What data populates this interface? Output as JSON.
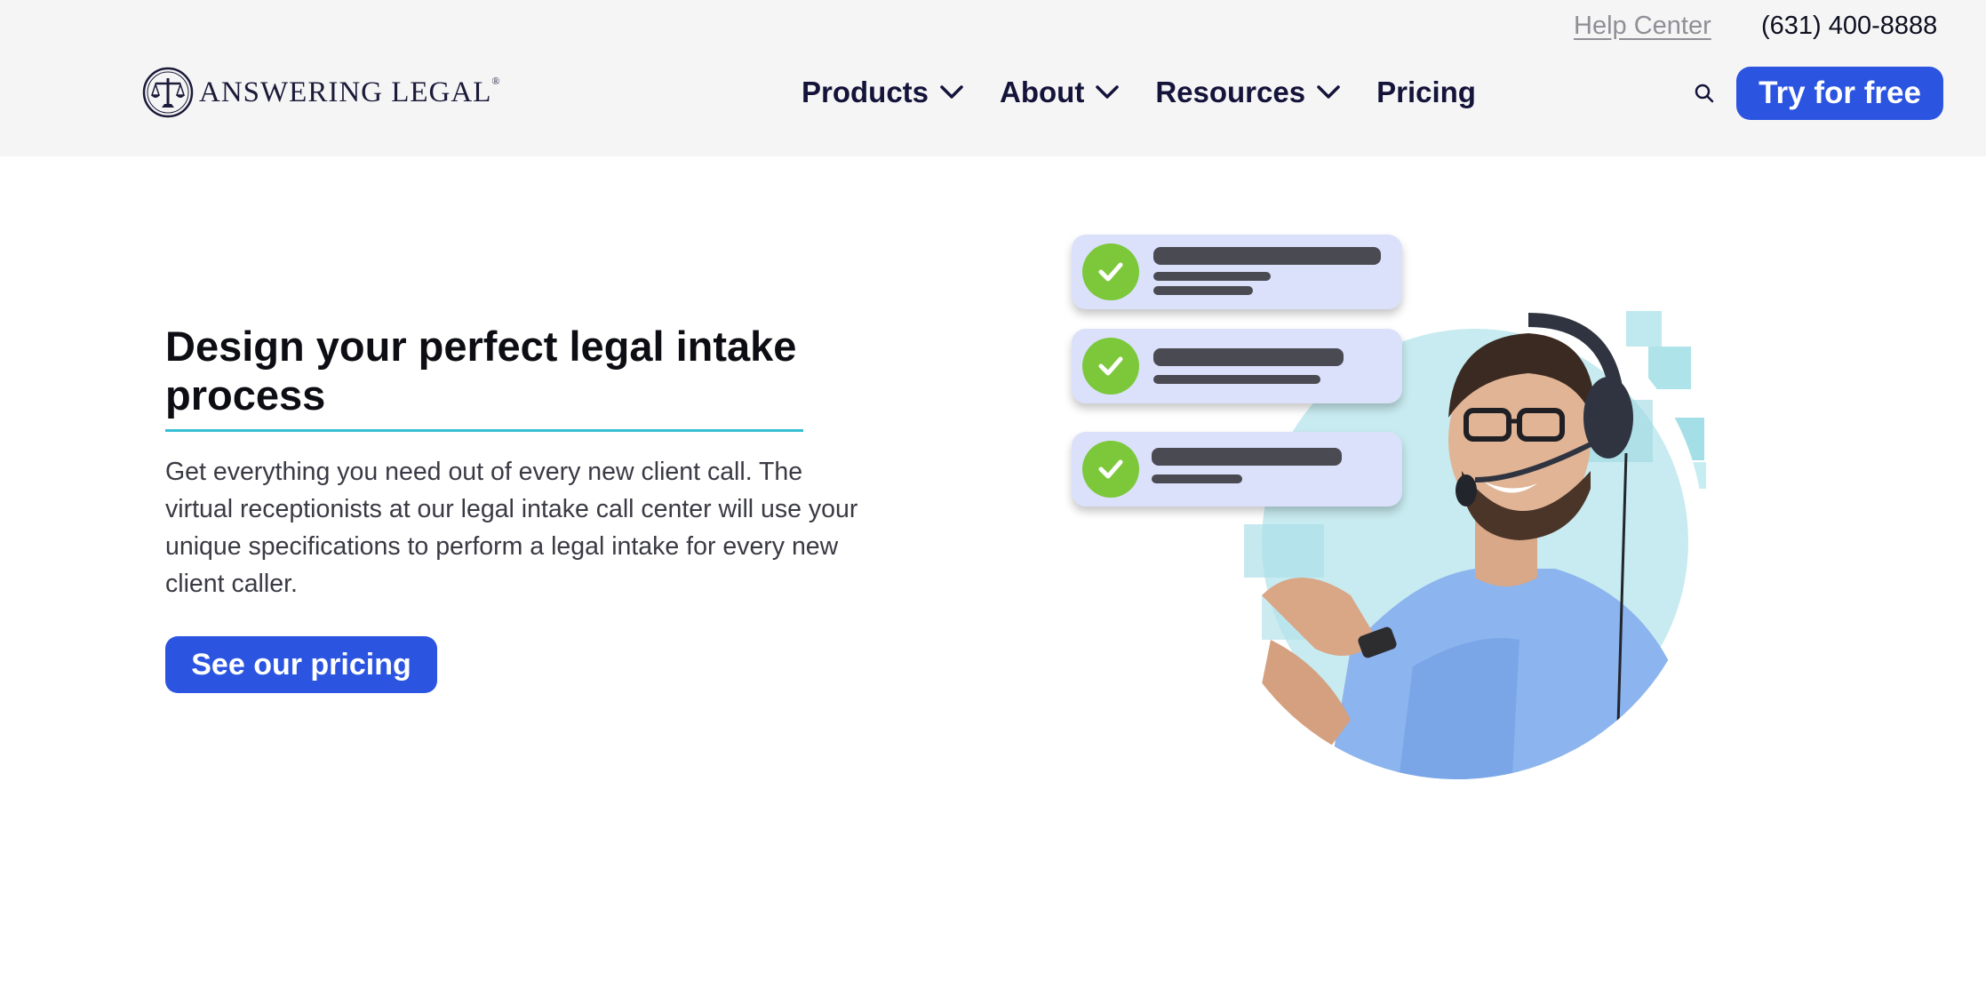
{
  "header": {
    "help_center": "Help Center",
    "phone": "(631) 400-8888",
    "logo_text": "ANSWERING LEGAL",
    "logo_reg": "®",
    "nav": [
      {
        "label": "Products"
      },
      {
        "label": "About"
      },
      {
        "label": "Resources"
      },
      {
        "label": "Pricing"
      }
    ],
    "cta_label": "Try for free",
    "search_icon": "search-icon"
  },
  "hero": {
    "title": "Design your perfect legal intake process",
    "body": "Get everything you need out of every new client call. The virtual receptionists at our legal intake call center will use your unique specifications to perform a legal intake for every new client caller.",
    "cta_label": "See our pricing"
  },
  "colors": {
    "accent_blue": "#2b54e1",
    "rule_teal": "#36bfd3",
    "check_green": "#7cc83a",
    "card_bg": "#dbe1fb"
  }
}
